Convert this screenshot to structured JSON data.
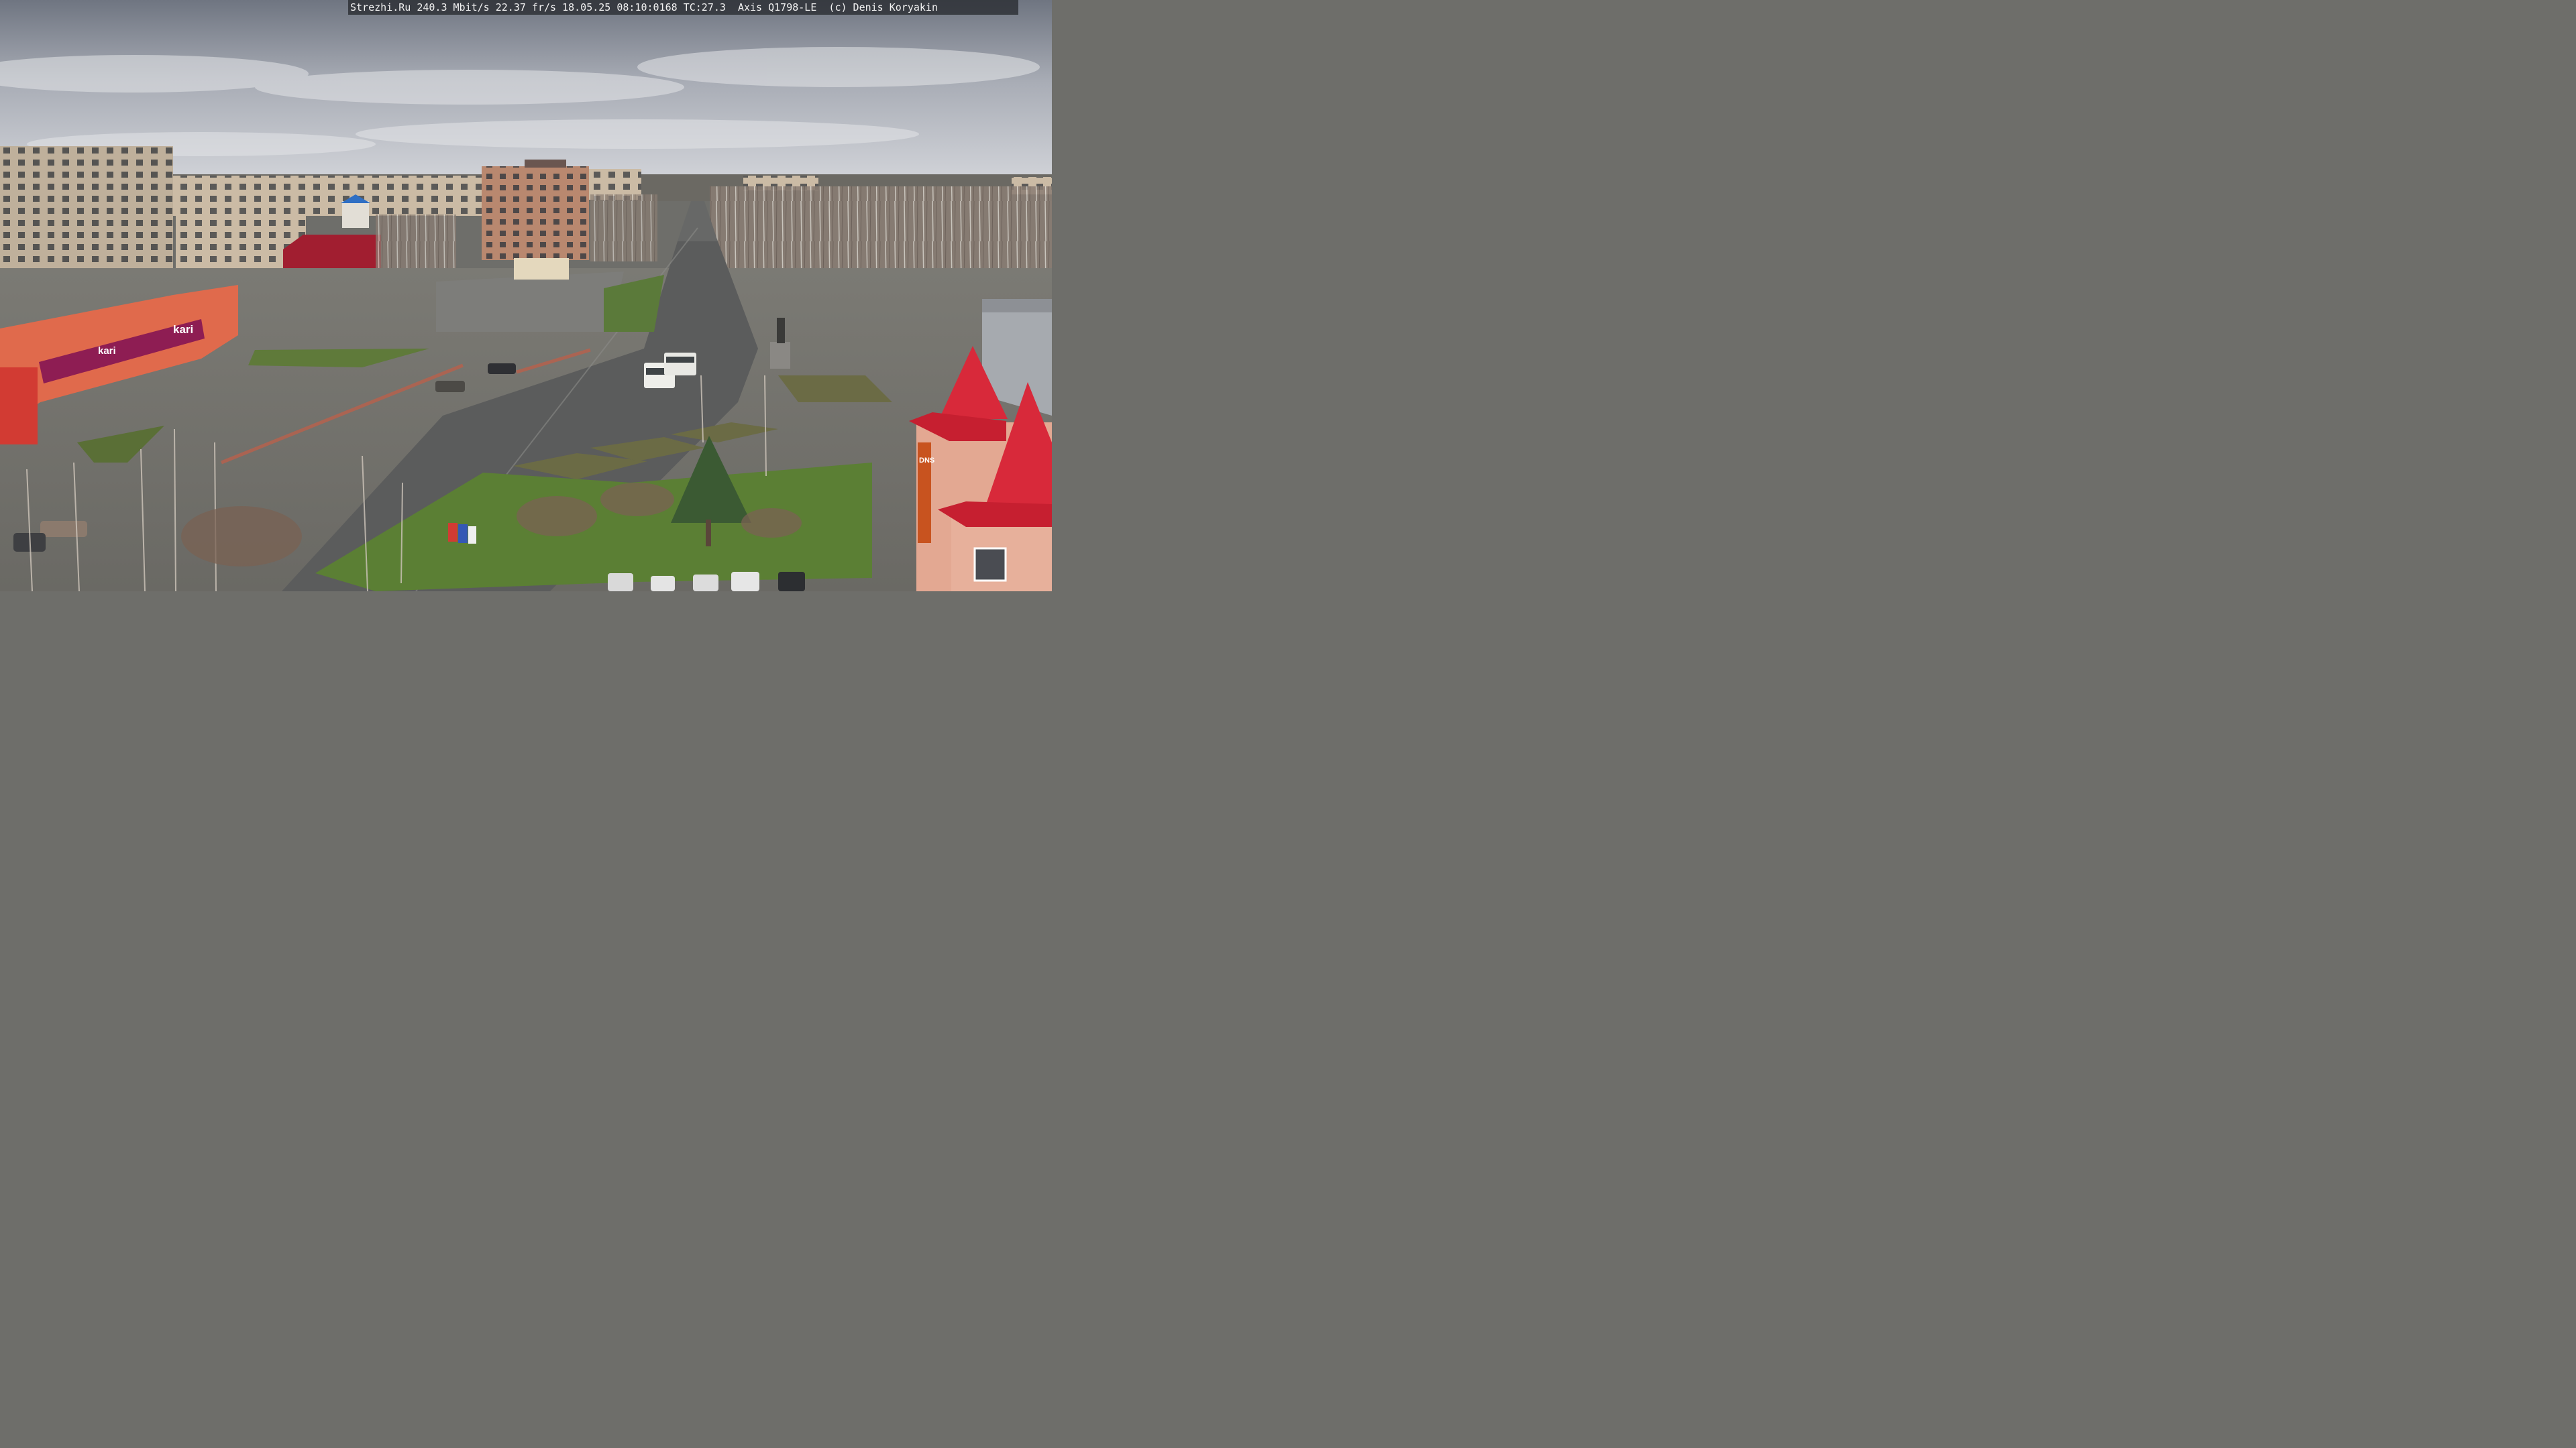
{
  "overlay": {
    "caption": "Strezhi.Ru 240.3 Mbit/s 22.37 fr/s 18.05.25 08:10:0168 TC:27.3  Axis Q1798-LE  (c) Denis Koryakin"
  },
  "signs": {
    "store_brand": "kari",
    "store_brand_small": "kari",
    "right_building": "DNS"
  },
  "colors": {
    "sky_top": "#6f7581",
    "sky_bottom": "#c9ccd2",
    "asphalt": "#6d6e6d",
    "grass": "#5f7a3a",
    "roof_red": "#d8293a",
    "shop_orange": "#e06a4c",
    "shop_magenta": "#8e1d53"
  }
}
